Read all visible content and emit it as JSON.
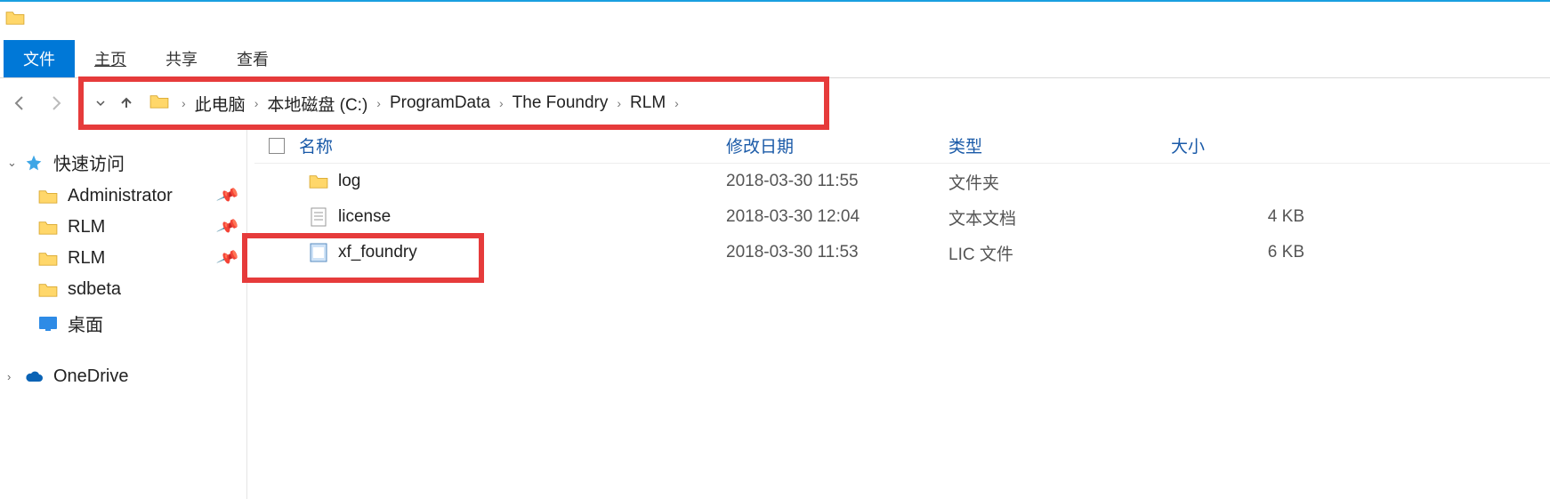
{
  "ribbon": {
    "file": "文件",
    "home": "主页",
    "share": "共享",
    "view": "查看"
  },
  "breadcrumb": {
    "items": [
      "此电脑",
      "本地磁盘 (C:)",
      "ProgramData",
      "The Foundry",
      "RLM"
    ]
  },
  "columns": {
    "name": "名称",
    "date": "修改日期",
    "type": "类型",
    "size": "大小"
  },
  "files": [
    {
      "name": "log",
      "date": "2018-03-30 11:55",
      "type": "文件夹",
      "size": "",
      "icon": "folder"
    },
    {
      "name": "license",
      "date": "2018-03-30 12:04",
      "type": "文本文档",
      "size": "4 KB",
      "icon": "txt"
    },
    {
      "name": "xf_foundry",
      "date": "2018-03-30 11:53",
      "type": "LIC 文件",
      "size": "6 KB",
      "icon": "lic"
    }
  ],
  "sidebar": {
    "quick": "快速访问",
    "items": [
      {
        "label": "Administrator"
      },
      {
        "label": "RLM"
      },
      {
        "label": "RLM"
      },
      {
        "label": "sdbeta"
      }
    ],
    "desktop": "桌面",
    "onedrive": "OneDrive"
  }
}
